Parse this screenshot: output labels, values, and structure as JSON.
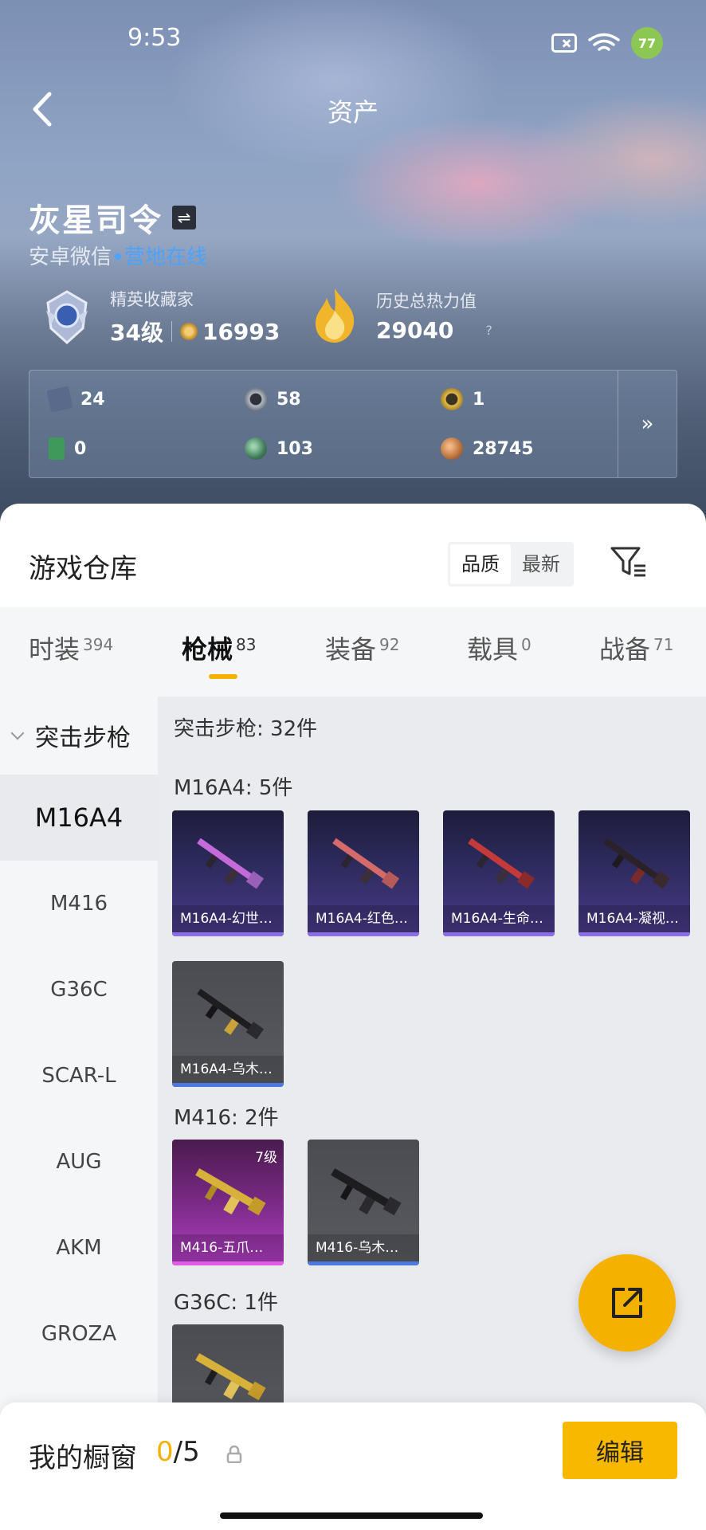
{
  "status_bar": {
    "time": "9:53",
    "battery": "77"
  },
  "header": {
    "title": "资产"
  },
  "profile": {
    "name": "灰星司令",
    "switch_symbol": "⇌",
    "platform": "安卓微信",
    "online_status": "营地在线",
    "rank_title": "精英收藏家",
    "rank_level": "34级",
    "rank_points": "16993",
    "heat_title": "历史总热力值",
    "heat_value": "29040",
    "help_symbol": "?"
  },
  "resources": [
    {
      "icon": "card-icon",
      "value": "24",
      "color": "#5a6a8a"
    },
    {
      "icon": "silver-coin-icon",
      "value": "58",
      "color": "#8a8f99"
    },
    {
      "icon": "gold-badge-icon",
      "value": "1",
      "color": "#d2a93a"
    },
    {
      "icon": "green-ticket-icon",
      "value": "0",
      "color": "#3d9a5a"
    },
    {
      "icon": "green-orb-icon",
      "value": "103",
      "color": "#4f8a6a"
    },
    {
      "icon": "bronze-coin-icon",
      "value": "28745",
      "color": "#b8703a"
    }
  ],
  "resources_more": "»",
  "warehouse": {
    "title": "游戏仓库",
    "sort_options": [
      "品质",
      "最新"
    ],
    "active_sort": "品质"
  },
  "tabs": [
    {
      "label": "时装",
      "count": "394"
    },
    {
      "label": "枪械",
      "count": "83",
      "active": true
    },
    {
      "label": "装备",
      "count": "92"
    },
    {
      "label": "载具",
      "count": "0"
    },
    {
      "label": "战备",
      "count": "71"
    }
  ],
  "sidebar": {
    "group": "突击步枪",
    "items": [
      "M16A4",
      "M416",
      "G36C",
      "SCAR-L",
      "AUG",
      "AKM",
      "GROZA"
    ],
    "active": "M16A4"
  },
  "content": {
    "summary": "突击步枪: 32件",
    "sections": [
      {
        "title": "M16A4: 5件"
      },
      {
        "title": "M416: 2件"
      },
      {
        "title": "G36C: 1件"
      }
    ],
    "cards": [
      {
        "label": "M16A4-幻世…",
        "rarity": "purple"
      },
      {
        "label": "M16A4-红色…",
        "rarity": "purple"
      },
      {
        "label": "M16A4-生命…",
        "rarity": "purple"
      },
      {
        "label": "M16A4-凝视…",
        "rarity": "purple"
      },
      {
        "label": "M16A4-乌木…",
        "rarity": "gray"
      },
      {
        "label": "M416-五爪…",
        "rarity": "pink",
        "level": "7级"
      },
      {
        "label": "M416-乌木…",
        "rarity": "gray"
      },
      {
        "label": "",
        "rarity": "gray"
      }
    ]
  },
  "showcase": {
    "label": "我的橱窗",
    "current": "0",
    "total": "/5",
    "edit_label": "编辑"
  }
}
